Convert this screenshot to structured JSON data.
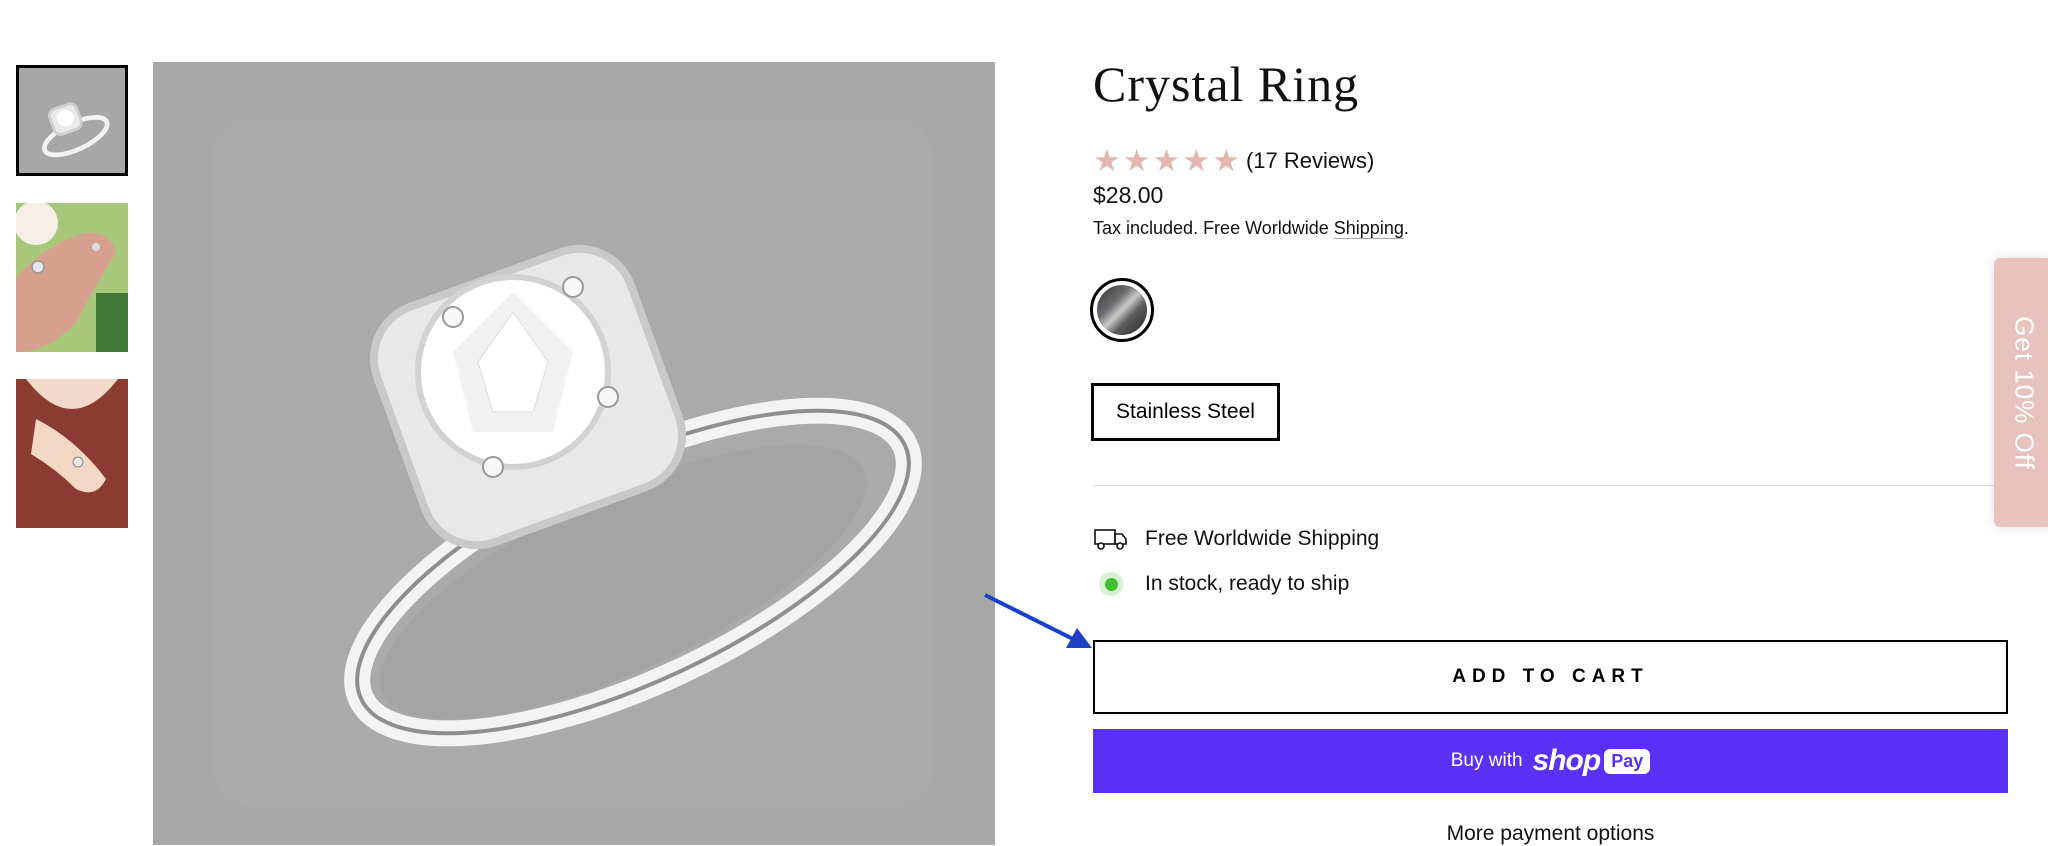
{
  "product": {
    "title": "Crystal Ring",
    "rating": {
      "stars": 5,
      "reviews_label": "(17 Reviews)"
    },
    "price": "$28.00",
    "tax_text": "Tax included. Free Worldwide ",
    "shipping_link": "Shipping",
    "tax_suffix": ".",
    "swatch_color": "#6d6f73",
    "variant_label": "Stainless Steel"
  },
  "features": {
    "shipping": "Free Worldwide Shipping",
    "stock": "In stock, ready to ship"
  },
  "actions": {
    "add_to_cart": "ADD TO CART",
    "buy_with": "Buy with",
    "shop": "shop",
    "pay": "Pay",
    "more_payment": "More payment options"
  },
  "side_tab": {
    "label": "Get 10% Off"
  },
  "colors": {
    "star": "#e3b7b0",
    "shop_pay": "#5a31f4",
    "side_tab": "#e7c3bd",
    "in_stock": "#3ec12c",
    "arrow": "#1d3fc6"
  },
  "icons": [
    "truck-icon",
    "in-stock-dot-icon",
    "star-icon",
    "annotation-arrow-icon"
  ]
}
